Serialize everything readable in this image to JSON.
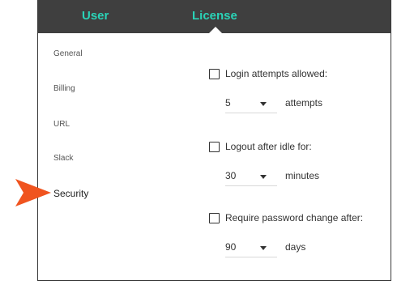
{
  "tabs": {
    "user": "User",
    "license": "License",
    "accent": "#2ad3b7",
    "bar_color": "#3f3f3f"
  },
  "nav": {
    "general": "General",
    "billing": "Billing",
    "url": "URL",
    "slack": "Slack",
    "security": "Security"
  },
  "pointer": {
    "color": "#f0541f"
  },
  "settings": {
    "login": {
      "label": "Login attempts allowed:",
      "value": "5",
      "unit": "attempts"
    },
    "logout": {
      "label": "Logout after idle for:",
      "value": "30",
      "unit": "minutes"
    },
    "password": {
      "label": "Require password change after:",
      "value": "90",
      "unit": "days"
    }
  }
}
